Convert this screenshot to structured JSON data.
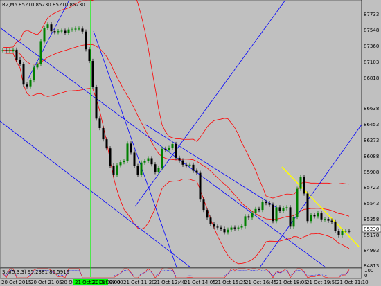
{
  "window": {
    "title": "R2,M5",
    "ohlc": "85210 85230 85210 85230"
  },
  "price_axis": {
    "ticks": [
      "87733",
      "87548",
      "87360",
      "87103",
      "86818",
      "86638",
      "86453",
      "86273",
      "86088",
      "85908",
      "85723",
      "85543",
      "85358",
      "85178",
      "84993",
      "84813"
    ],
    "current_price": "85230"
  },
  "time_axis": {
    "ticks": [
      "20 Oct 2015",
      "20 Oct 21:05",
      "20 Oct 2",
      "21 Oct 09:00",
      "21 Oct 11:20",
      "21 Oct 12:40",
      "21 Oct 14:05",
      "21 Oct 15:25",
      "21 Oct 16:45",
      "21 Oct 18:05",
      "21 Oct 19:50",
      "21 Oct 21:10"
    ],
    "cursor_label": "21 Oct 2015 09:00"
  },
  "indicator": {
    "label": "Sto(5,3,3) 95.2381 86.5915",
    "scale_top": "100",
    "scale_bottom": "0"
  },
  "colors": {
    "background": "#c0c0c0",
    "candle_up": "#008000",
    "candle_down": "#000000",
    "bollinger": "#ff0000",
    "trendline": "#0000ff",
    "trendline_yellow": "#ffff00",
    "vertical_marker": "#00ff00",
    "price_tag": "#ffffff"
  },
  "chart_data": {
    "type": "candlestick",
    "series": [
      {
        "name": "Price",
        "values": [
          87335,
          87330,
          87335,
          87340,
          87225,
          87175,
          86935,
          86915,
          86985,
          87135,
          87175,
          87440,
          87595,
          87635,
          87555,
          87545,
          87555,
          87560,
          87540,
          87575,
          87575,
          87585,
          87585,
          87550,
          87345,
          87210,
          86905,
          86540,
          86430,
          86300,
          86195,
          85995,
          85890,
          86000,
          86035,
          86050,
          86250,
          86145,
          85990,
          85890,
          86030,
          86045,
          86080,
          86010,
          85920,
          85970,
          86190,
          86180,
          86200,
          86245,
          86085,
          86055,
          86005,
          86000,
          86005,
          85935,
          85910,
          85600,
          85480,
          85390,
          85315,
          85285,
          85275,
          85260,
          85220,
          85250,
          85275,
          85265,
          85275,
          85290,
          85405,
          85390,
          85445,
          85490,
          85480,
          85570,
          85560,
          85540,
          85350,
          85510,
          85470,
          85500,
          85510,
          85285,
          85400,
          85725,
          85860,
          85670,
          85350,
          85420,
          85405,
          85440,
          85370,
          85375,
          85355,
          85345,
          85235,
          85185,
          85235,
          85235,
          85230
        ]
      }
    ]
  }
}
